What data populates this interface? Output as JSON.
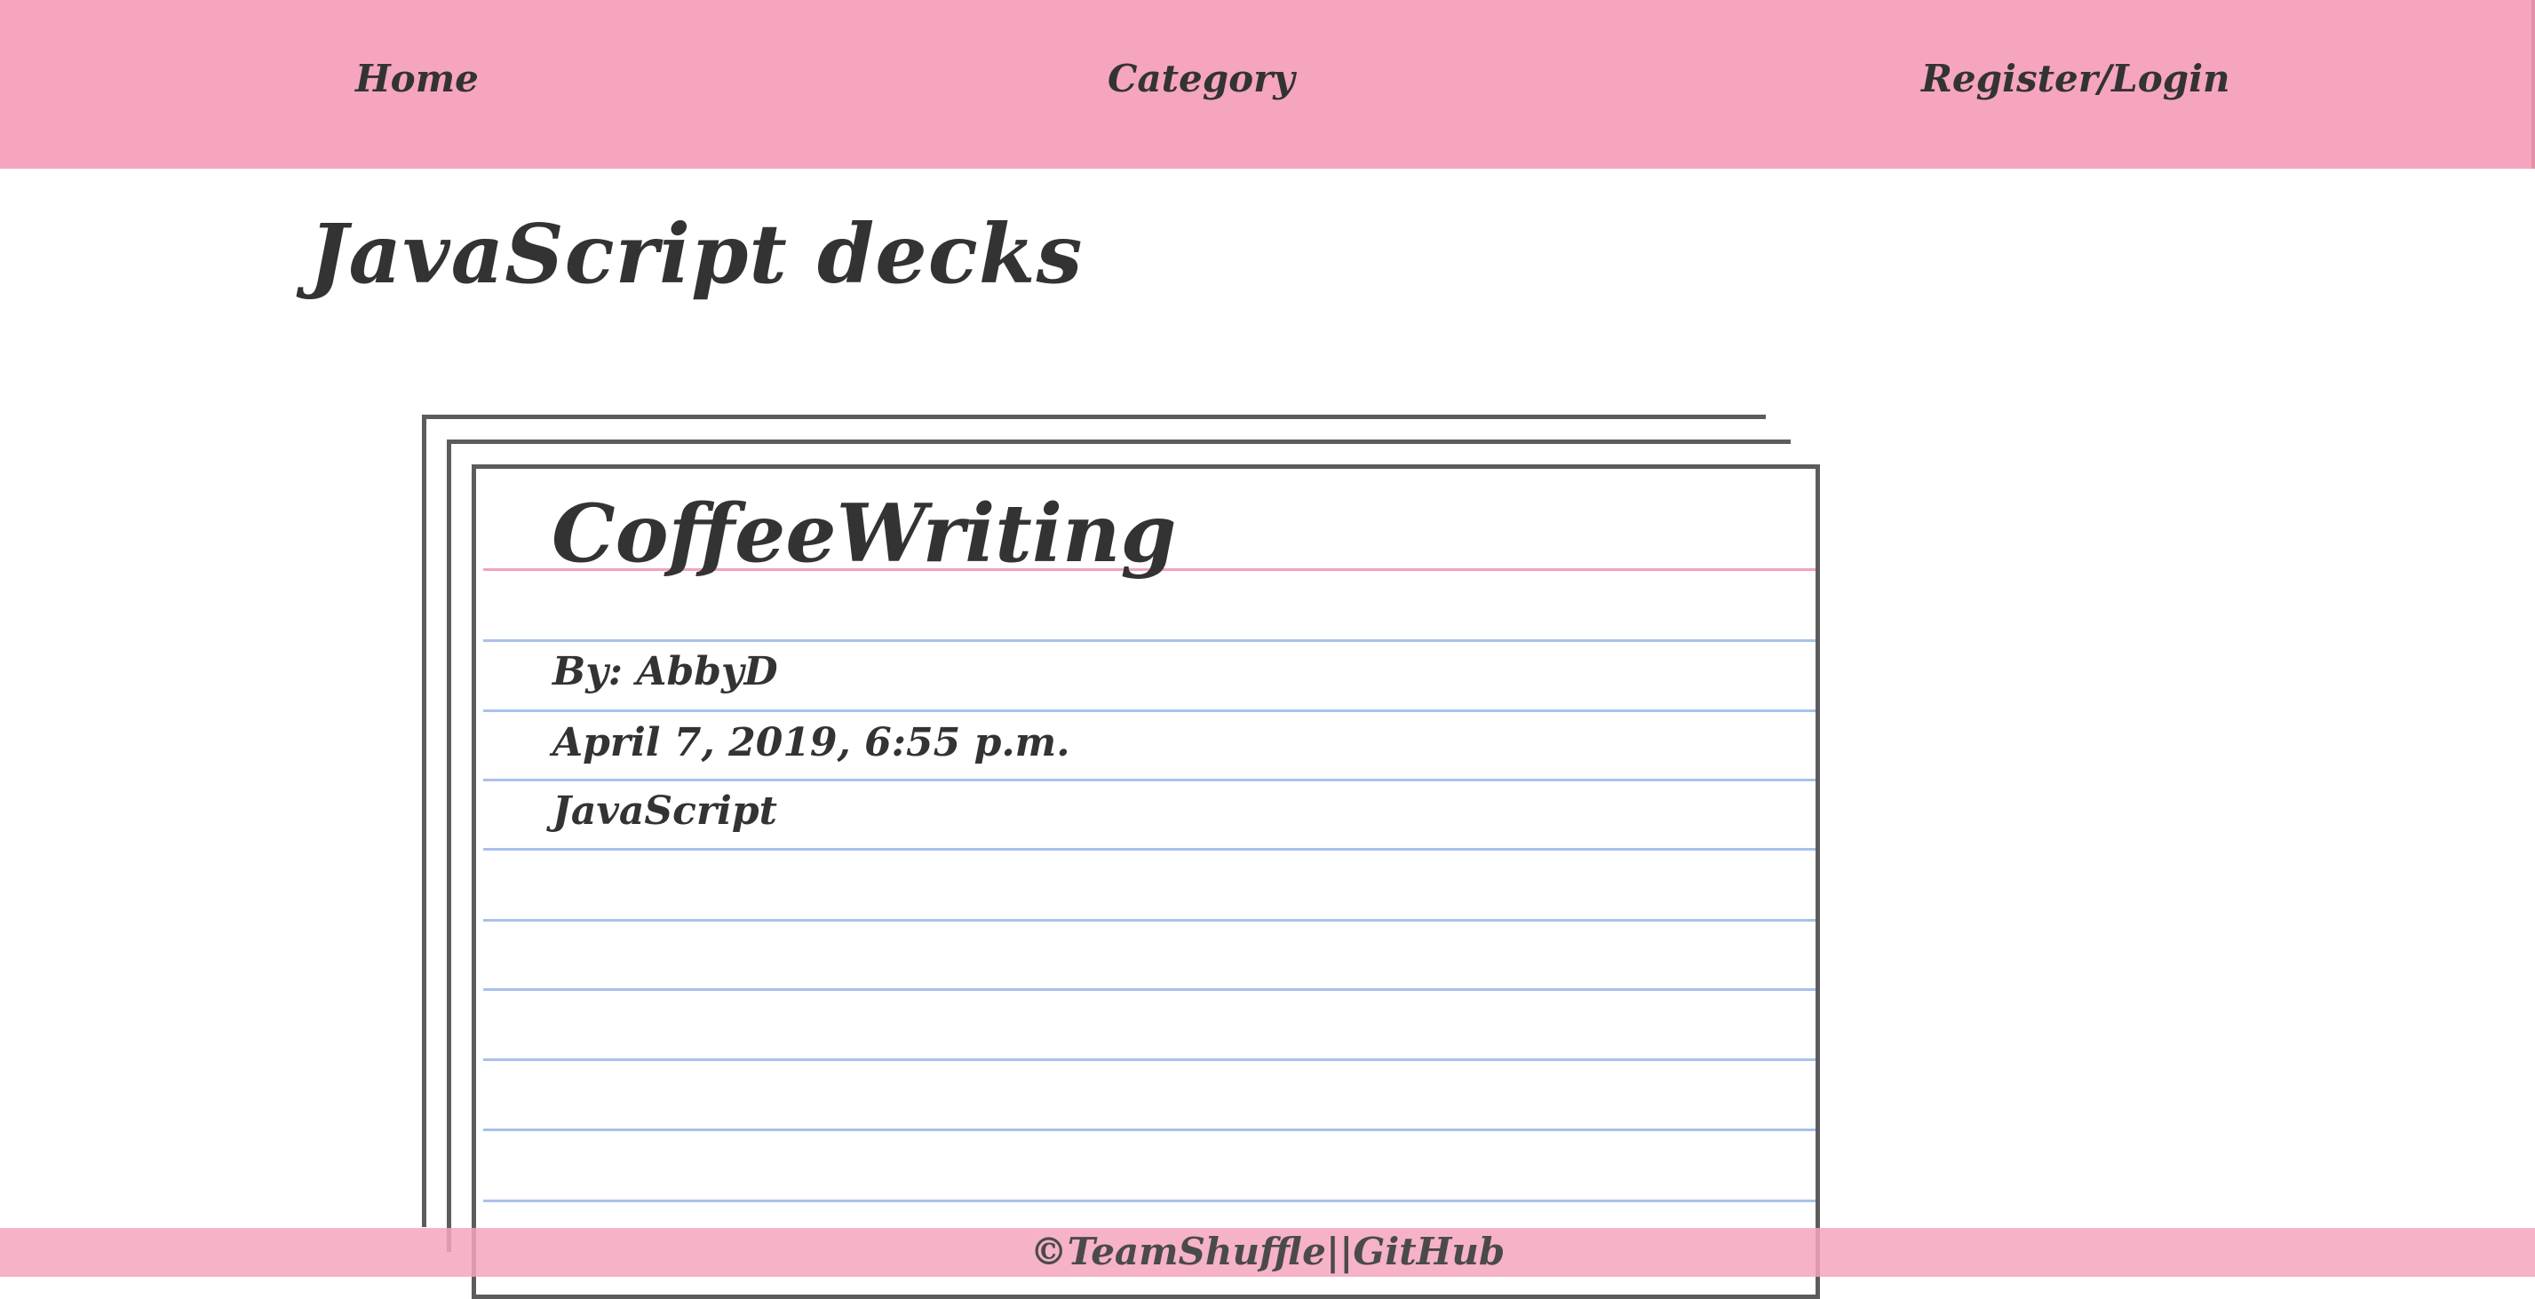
{
  "nav": {
    "home": "Home",
    "category": "Category",
    "register_login": "Register/Login"
  },
  "page": {
    "title": "JavaScript decks"
  },
  "decks": [
    {
      "title": "CoffeeWriting",
      "author": "By: AbbyD",
      "date": "April 7, 2019, 6:55 p.m.",
      "category": "JavaScript"
    }
  ],
  "footer": {
    "copyright": "©TeamShuffle",
    "separator": "||",
    "github": "GitHub"
  },
  "colors": {
    "nav_background": "#f5a5bd",
    "card_border": "#5c5c5c",
    "ruled_line": "#a9c0ec",
    "margin_line": "#f0a3bd",
    "text": "#333333"
  }
}
